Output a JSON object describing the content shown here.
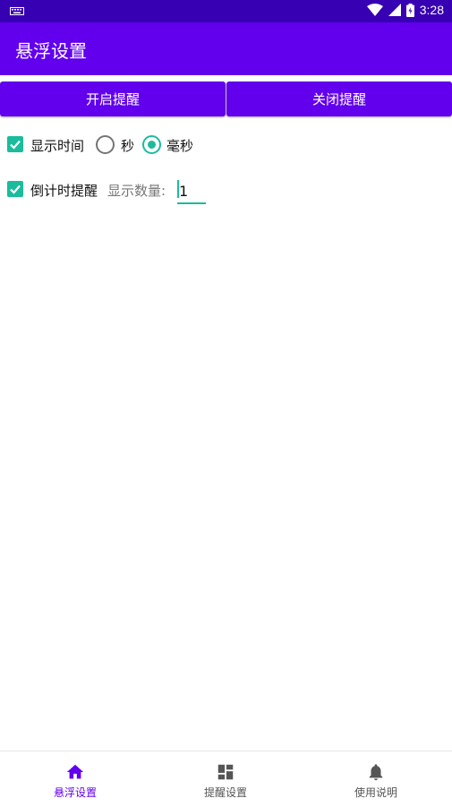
{
  "status_bar": {
    "time": "3:28"
  },
  "app_bar": {
    "title": "悬浮设置"
  },
  "buttons": {
    "open": "开启提醒",
    "close": "关闭提醒"
  },
  "options": {
    "show_time": {
      "label": "显示时间",
      "checked": true
    },
    "unit_seconds": {
      "label": "秒",
      "selected": false
    },
    "unit_millis": {
      "label": "毫秒",
      "selected": true
    },
    "countdown": {
      "label": "倒计时提醒",
      "checked": true
    },
    "count_label": "显示数量:",
    "count_value": "1"
  },
  "bottom_nav": {
    "items": [
      {
        "label": "悬浮设置",
        "icon": "home-icon",
        "active": true
      },
      {
        "label": "提醒设置",
        "icon": "dashboard-icon",
        "active": false
      },
      {
        "label": "使用说明",
        "icon": "bell-icon",
        "active": false
      }
    ]
  },
  "colors": {
    "primary": "#6200ee",
    "primary_dark": "#3700b3",
    "accent": "#1abc9c"
  }
}
